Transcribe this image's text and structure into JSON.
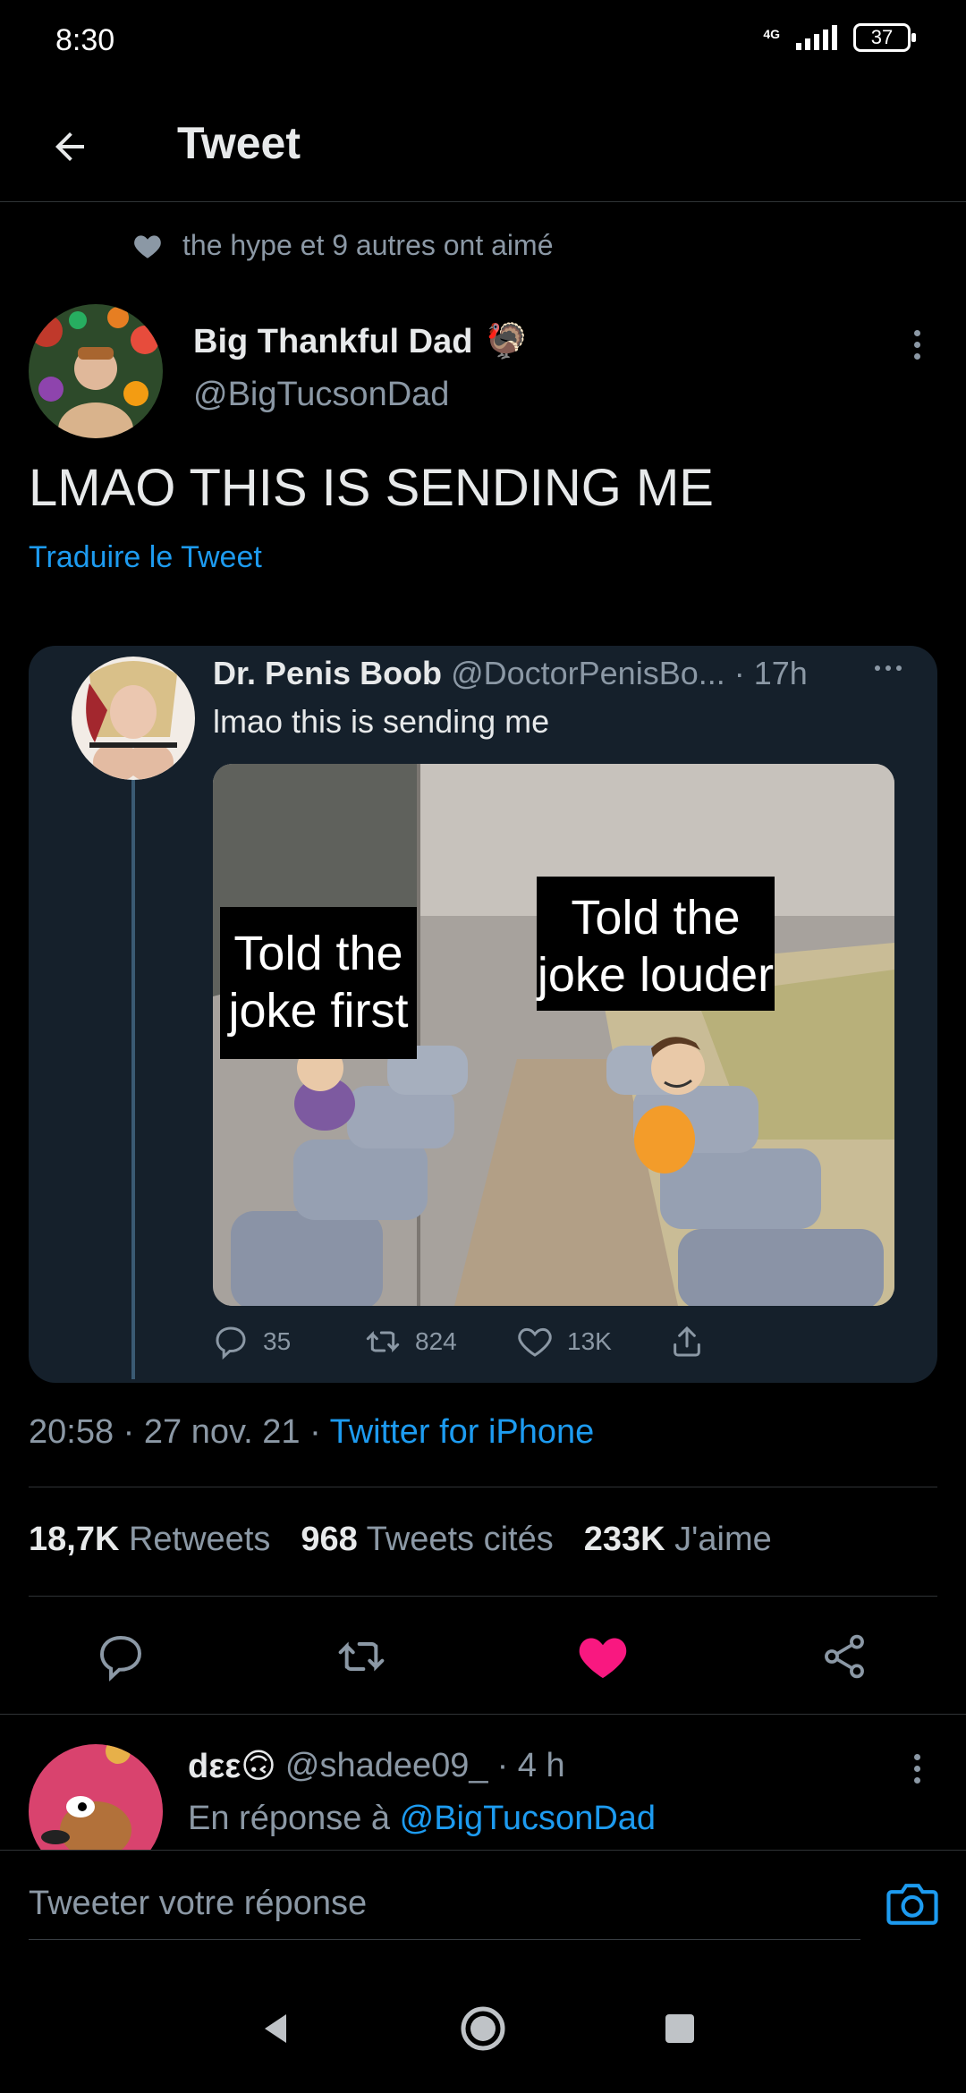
{
  "status_bar": {
    "time": "8:30",
    "network": "4G",
    "battery": "37"
  },
  "header": {
    "title": "Tweet",
    "back_icon": "arrow-left-icon"
  },
  "social_context": {
    "text": "the hype et 9 autres ont aimé",
    "icon": "heart-icon"
  },
  "tweet": {
    "author_name": "Big Thankful Dad",
    "author_emoji": "🦃",
    "author_handle": "@BigTucsonDad",
    "text": "LMAO THIS IS SENDING ME",
    "translate_label": "Traduire le Tweet",
    "time": "20:58",
    "date": "27 nov. 21",
    "source": "Twitter for iPhone",
    "retweets_count": "18,7K",
    "retweets_label": "Retweets",
    "quotes_count": "968",
    "quotes_label": "Tweets cités",
    "likes_count": "233K",
    "likes_label": "J'aime",
    "liked": true,
    "like_color": "#f91880"
  },
  "quoted_tweet": {
    "author_name": "Dr. Penis Boob",
    "author_handle": "@DoctorPenisBo...",
    "age": "· 17h",
    "text": "lmao this is sending me",
    "meme_caption_left": "Told the joke first",
    "meme_caption_right": "Told the joke louder",
    "replies": "35",
    "retweets": "824",
    "likes": "13K"
  },
  "reply": {
    "author_name": "dεε🙃",
    "author_handle": "@shadee09_",
    "age": "· 4 h",
    "reply_prefix": "En réponse à",
    "reply_to": "@BigTucsonDad"
  },
  "compose": {
    "placeholder": "Tweeter votre réponse"
  },
  "colors": {
    "accent": "#1d9bf0",
    "background": "#000000",
    "card": "#15202b"
  }
}
